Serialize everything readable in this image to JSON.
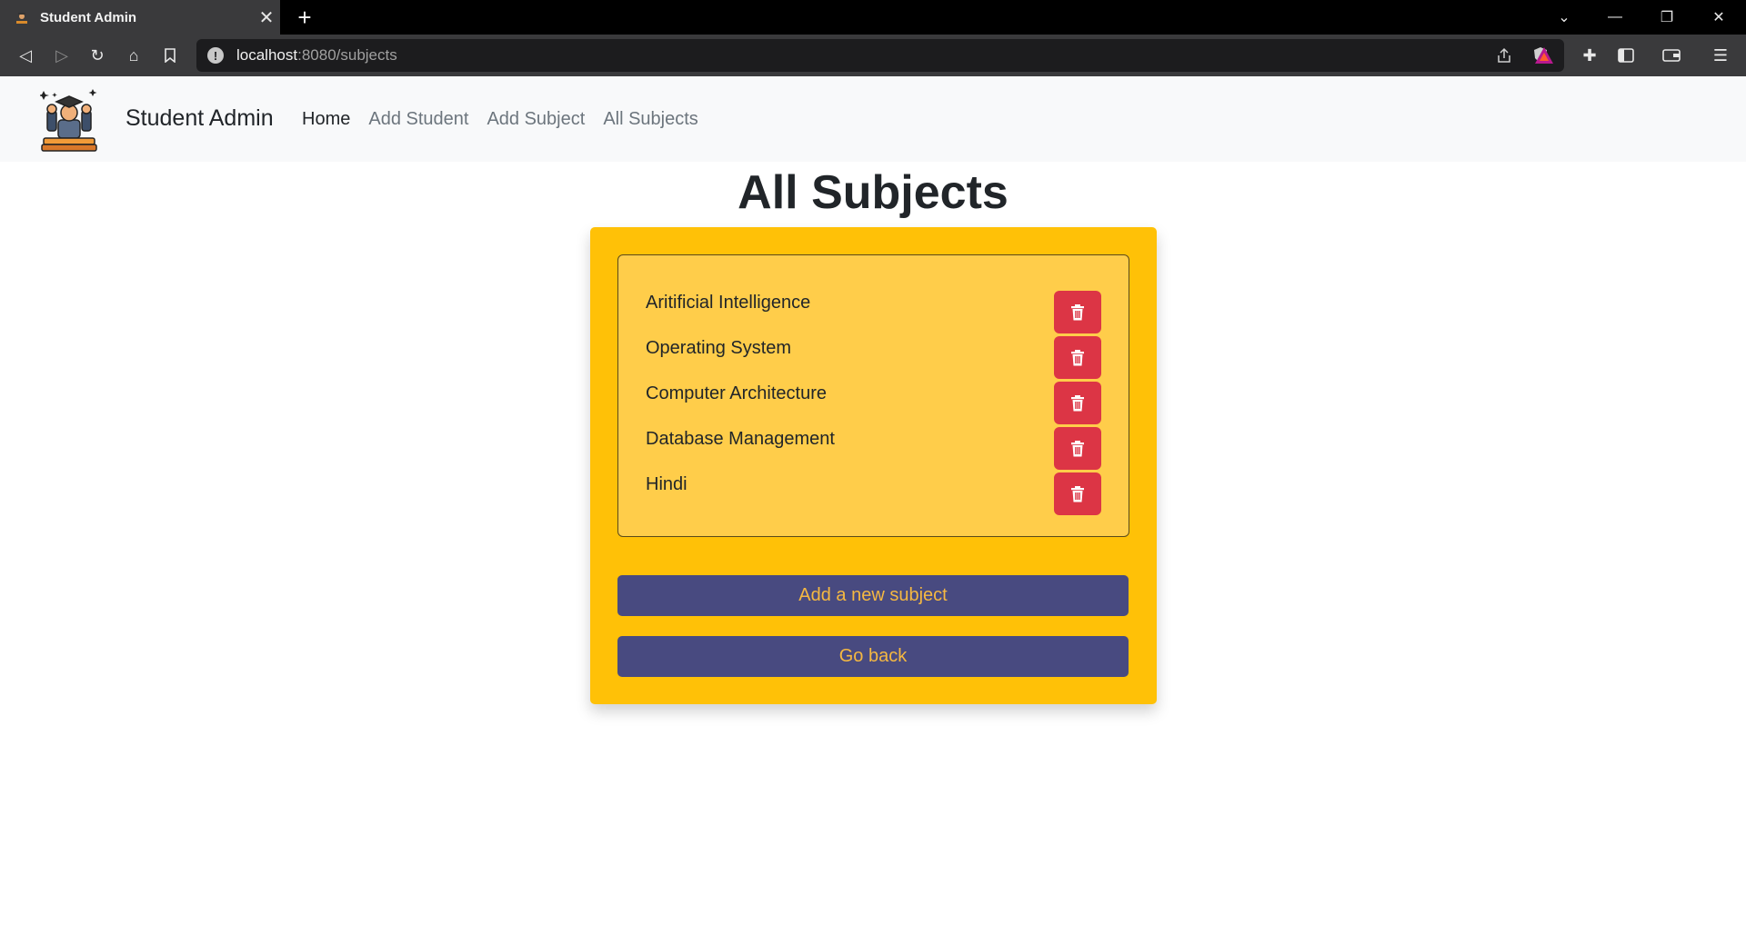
{
  "browser": {
    "tab_title": "Student Admin",
    "tab_close": "✕",
    "new_tab": "+",
    "url_host": "localhost",
    "url_path": ":8080/subjects"
  },
  "navbar": {
    "brand": "Student Admin",
    "links": [
      {
        "label": "Home",
        "active": true
      },
      {
        "label": "Add Student",
        "active": false
      },
      {
        "label": "Add Subject",
        "active": false
      },
      {
        "label": "All Subjects",
        "active": false
      }
    ]
  },
  "main": {
    "title": "All Subjects",
    "subjects": [
      {
        "name": "Aritificial Intelligence"
      },
      {
        "name": "Operating System"
      },
      {
        "name": "Computer Architecture"
      },
      {
        "name": "Database Management"
      },
      {
        "name": "Hindi"
      }
    ],
    "add_button": "Add a new subject",
    "back_button": "Go back"
  },
  "icons": {
    "delete": "trash-icon",
    "logo": "graduate-icon"
  },
  "colors": {
    "card": "#ffc107",
    "list_bg": "#ffcd4a",
    "delete": "#dc3545",
    "action_bg": "#484a80",
    "action_text": "#f5b841"
  }
}
